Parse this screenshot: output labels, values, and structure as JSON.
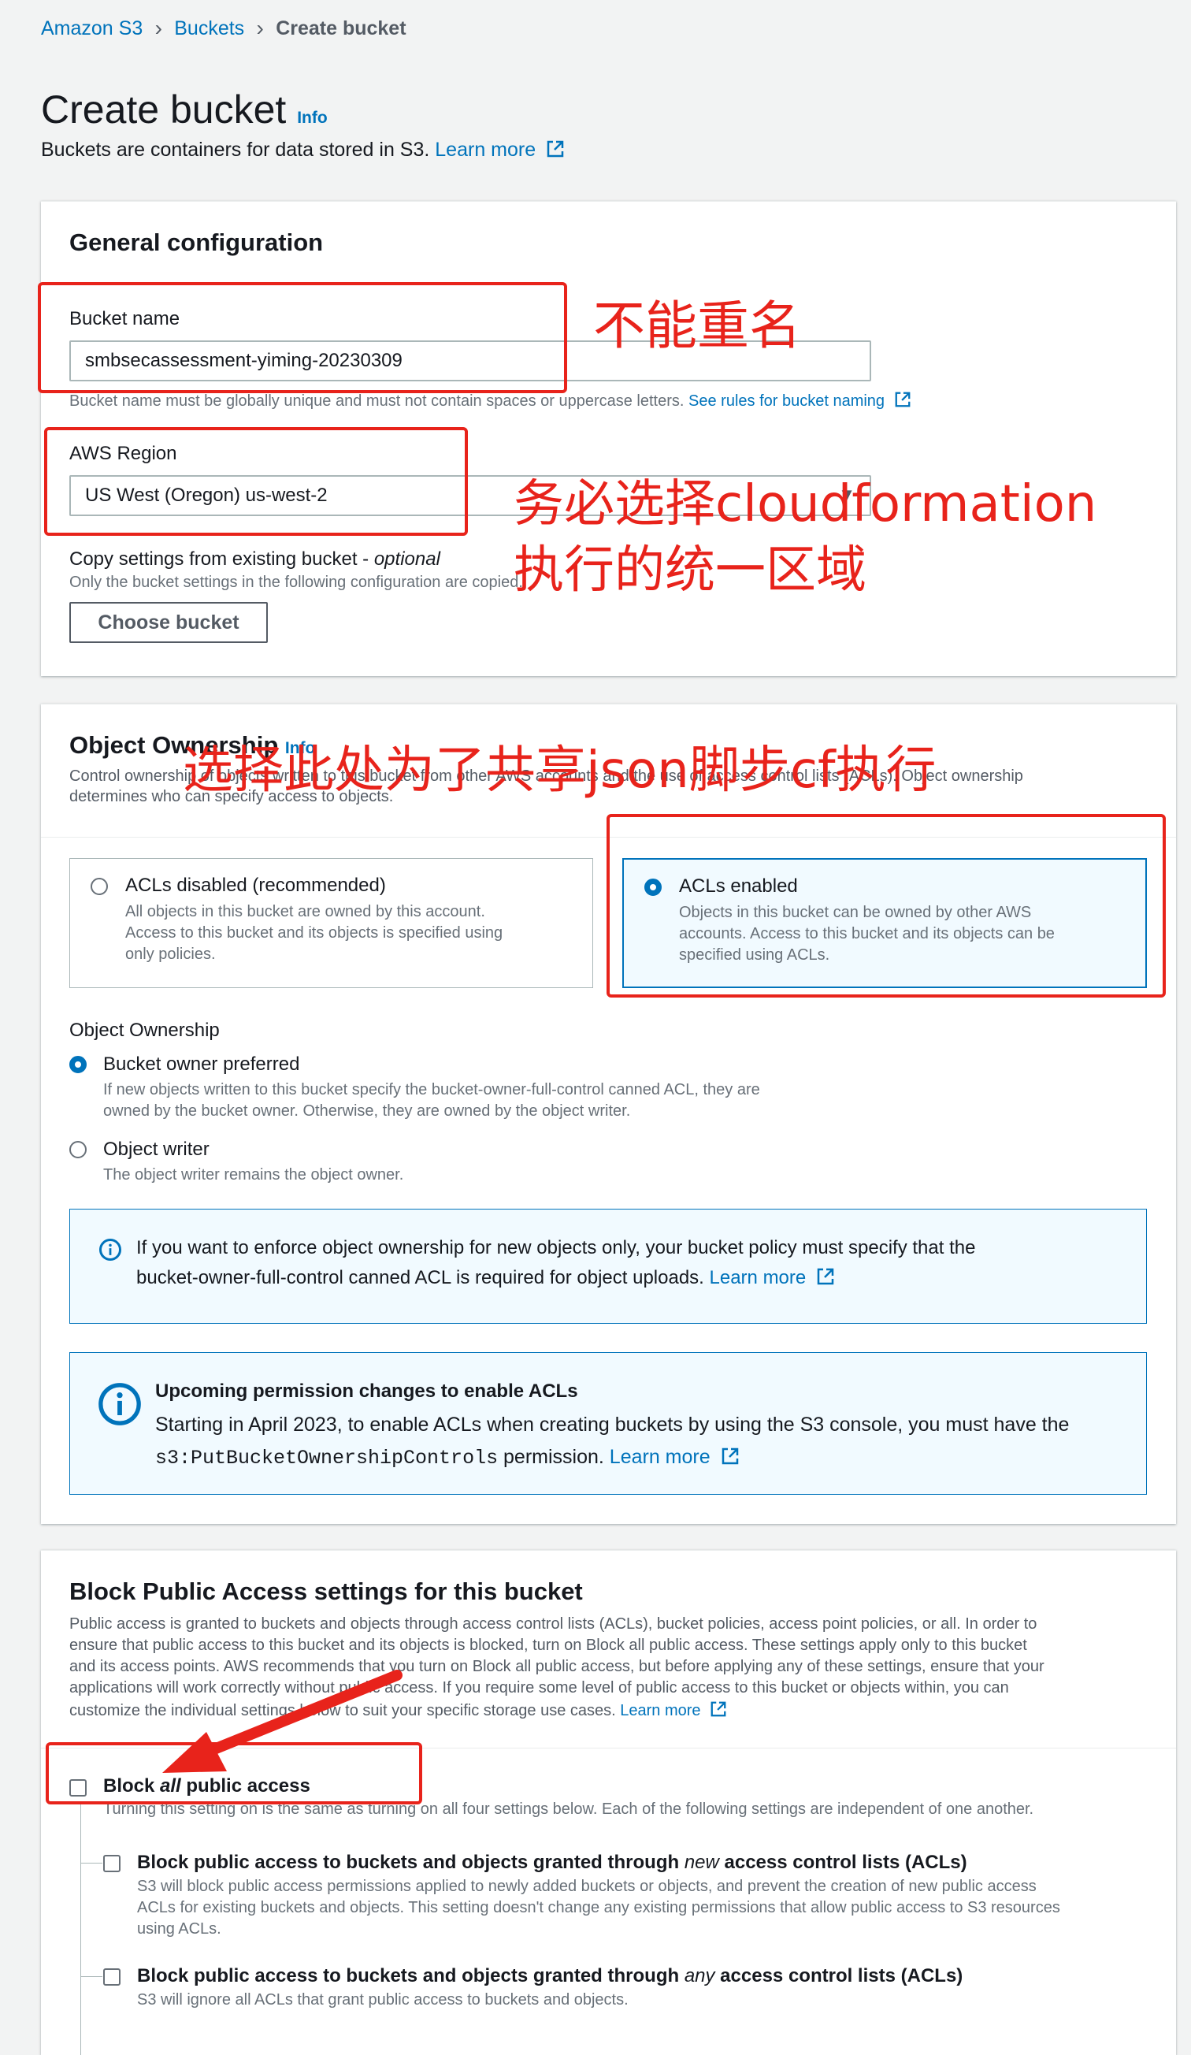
{
  "breadcrumb": {
    "items": [
      "Amazon S3",
      "Buckets",
      "Create bucket"
    ]
  },
  "header": {
    "title": "Create bucket",
    "info": "Info",
    "subtitle": "Buckets are containers for data stored in S3.",
    "learn_more": "Learn more"
  },
  "general": {
    "title": "General configuration",
    "bucket_name_label": "Bucket name",
    "bucket_name_value": "smbsecassessment-yiming-20230309",
    "bucket_name_hint": "Bucket name must be globally unique and must not contain spaces or uppercase letters.",
    "rules_link": "See rules for bucket naming",
    "region_label": "AWS Region",
    "region_value": "US West (Oregon) us-west-2",
    "copy_label": "Copy settings from existing bucket - ",
    "copy_optional": "optional",
    "copy_hint": "Only the bucket settings in the following configuration are copied.",
    "choose_bucket": "Choose bucket"
  },
  "ownership": {
    "title": "Object Ownership",
    "info": "Info",
    "desc_line1": "Control ownership of objects written to this bucket from other AWS accounts and the use of access control lists (ACLs). Object ownership",
    "desc_line2": "determines who can specify access to objects.",
    "option_disabled_title": "ACLs disabled (recommended)",
    "option_disabled_desc": [
      "All objects in this bucket are owned by this account.",
      "Access to this bucket and its objects is specified using",
      "only policies."
    ],
    "option_enabled_title": "ACLs enabled",
    "option_enabled_desc": [
      "Objects in this bucket can be owned by other AWS",
      "accounts. Access to this bucket and its objects can be",
      "specified using ACLs."
    ],
    "sub_label": "Object Ownership",
    "owner_preferred_title": "Bucket owner preferred",
    "owner_preferred_desc1": "If new objects written to this bucket specify the bucket-owner-full-control canned ACL, they are",
    "owner_preferred_desc2": "owned by the bucket owner. Otherwise, they are owned by the object writer.",
    "object_writer_title": "Object writer",
    "object_writer_desc": "The object writer remains the object owner.",
    "alert1_line1": "If you want to enforce object ownership for new objects only, your bucket policy must specify that the",
    "alert1_line2": "bucket-owner-full-control canned ACL is required for object uploads.",
    "alert1_link": "Learn more",
    "alert2_title": "Upcoming permission changes to enable ACLs",
    "alert2_line1": "Starting in April 2023, to enable ACLs when creating buckets by using the S3 console, you must have the",
    "alert2_code": "s3:PutBucketOwnershipControls",
    "alert2_line2_rest": " permission.",
    "alert2_link": "Learn more"
  },
  "block": {
    "title": "Block Public Access settings for this bucket",
    "desc": [
      "Public access is granted to buckets and objects through access control lists (ACLs), bucket policies, access point policies, or all. In order to",
      "ensure that public access to this bucket and its objects is blocked, turn on Block all public access. These settings apply only to this bucket",
      "and its access points. AWS recommends that you turn on Block all public access, but before applying any of these settings, ensure that your",
      "applications will work correctly without public access. If you require some level of public access to this bucket or objects within, you can",
      "customize the individual settings below to suit your specific storage use cases."
    ],
    "learn_more": "Learn more",
    "all_pre": "Block ",
    "all_em": "all",
    "all_post": " public access",
    "all_desc": "Turning this setting on is the same as turning on all four settings below. Each of the following settings are independent of one another.",
    "opt1_pre": "Block public access to buckets and objects granted through ",
    "opt1_em": "new",
    "opt1_post": " access control lists (ACLs)",
    "opt1_desc": [
      "S3 will block public access permissions applied to newly added buckets or objects, and prevent the creation of new public access",
      "ACLs for existing buckets and objects. This setting doesn't change any existing permissions that allow public access to S3 resources",
      "using ACLs."
    ],
    "opt2_pre": "Block public access to buckets and objects granted through ",
    "opt2_em": "any",
    "opt2_post": " access control lists (ACLs)",
    "opt2_desc": "S3 will ignore all ACLs that grant public access to buckets and objects."
  },
  "annotations": {
    "unique_name": "不能重名",
    "region_line1": "务必选择cloudformation",
    "region_line2": "执行的统一区域",
    "acl_note": "选择此处为了共享json脚步cf执行",
    "accent": "#e8231b"
  }
}
